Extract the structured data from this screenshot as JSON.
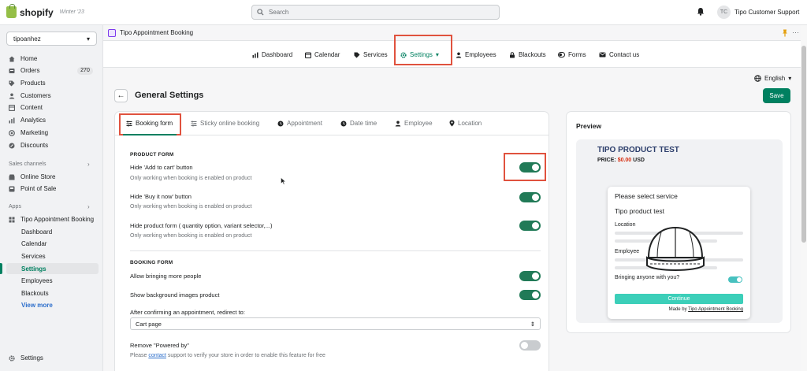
{
  "topbar": {
    "brand": "shopify",
    "edition": "Winter '23",
    "search_placeholder": "Search",
    "user_initials": "TC",
    "user_name": "Tipo Customer Support"
  },
  "sidebar": {
    "store": "tipoanhez",
    "items": [
      {
        "label": "Home",
        "icon": "home-icon"
      },
      {
        "label": "Orders",
        "icon": "orders-icon",
        "badge": "270"
      },
      {
        "label": "Products",
        "icon": "tag-icon"
      },
      {
        "label": "Customers",
        "icon": "person-icon"
      },
      {
        "label": "Content",
        "icon": "content-icon"
      },
      {
        "label": "Analytics",
        "icon": "chart-icon"
      },
      {
        "label": "Marketing",
        "icon": "target-icon"
      },
      {
        "label": "Discounts",
        "icon": "discount-icon"
      }
    ],
    "sales_channels_label": "Sales channels",
    "sales_channels": [
      {
        "label": "Online Store",
        "icon": "store-icon"
      },
      {
        "label": "Point of Sale",
        "icon": "pos-icon"
      }
    ],
    "apps_label": "Apps",
    "app_name": "Tipo Appointment Booking",
    "app_sub_items": [
      "Dashboard",
      "Calendar",
      "Services",
      "Settings",
      "Employees",
      "Blackouts"
    ],
    "view_more": "View more",
    "settings": "Settings"
  },
  "app_header": {
    "title": "Tipo Appointment Booking"
  },
  "topnav": [
    {
      "label": "Dashboard",
      "icon": "bar-chart-icon"
    },
    {
      "label": "Calendar",
      "icon": "calendar-icon"
    },
    {
      "label": "Services",
      "icon": "tag-icon"
    },
    {
      "label": "Settings",
      "icon": "gear-icon"
    },
    {
      "label": "Employees",
      "icon": "person-icon"
    },
    {
      "label": "Blackouts",
      "icon": "lock-icon"
    },
    {
      "label": "Forms",
      "icon": "toggle-icon"
    },
    {
      "label": "Contact us",
      "icon": "mail-icon"
    }
  ],
  "language": "English",
  "page": {
    "title": "General Settings",
    "save": "Save"
  },
  "tabs": [
    "Booking form",
    "Sticky online booking",
    "Appointment",
    "Date time",
    "Employee",
    "Location"
  ],
  "product_form": {
    "heading": "PRODUCT FORM",
    "rows": [
      {
        "label": "Hide 'Add to cart' button",
        "help": "Only working when booking is enabled on product",
        "on": true
      },
      {
        "label": "Hide 'Buy it now' button",
        "help": "Only working when booking is enabled on product",
        "on": true
      },
      {
        "label": "Hide product form ( quantity option, variant selector,...)",
        "help": "Only working when booking is enabled on product",
        "on": true
      }
    ]
  },
  "booking_form": {
    "heading": "BOOKING FORM",
    "allow_more": "Allow bringing more people",
    "show_bg": "Show background images product",
    "redirect_label": "After confirming an appointment, redirect to:",
    "redirect_value": "Cart page",
    "remove_powered": "Remove \"Powered by\"",
    "help_pre": "Please",
    "help_link": "contact",
    "help_post": "support to verify your store in order to enable this feature for free"
  },
  "preview": {
    "title": "Preview",
    "product_name": "TIPO PRODUCT TEST",
    "price_label": "PRICE:",
    "price_value": "$0.00",
    "currency": "USD",
    "widget_title": "Please select service",
    "widget_product": "Tipo product test",
    "location": "Location",
    "employee": "Employee",
    "bringing": "Bringing anyone with you?",
    "continue": "Continue",
    "made_by": "Made by",
    "made_by_link": "Tipo Appointment Booking"
  },
  "colors": {
    "accent": "#008060",
    "highlight": "#e0523e",
    "toggle_on": "#217a57",
    "widget_button": "#3ccfb9"
  }
}
